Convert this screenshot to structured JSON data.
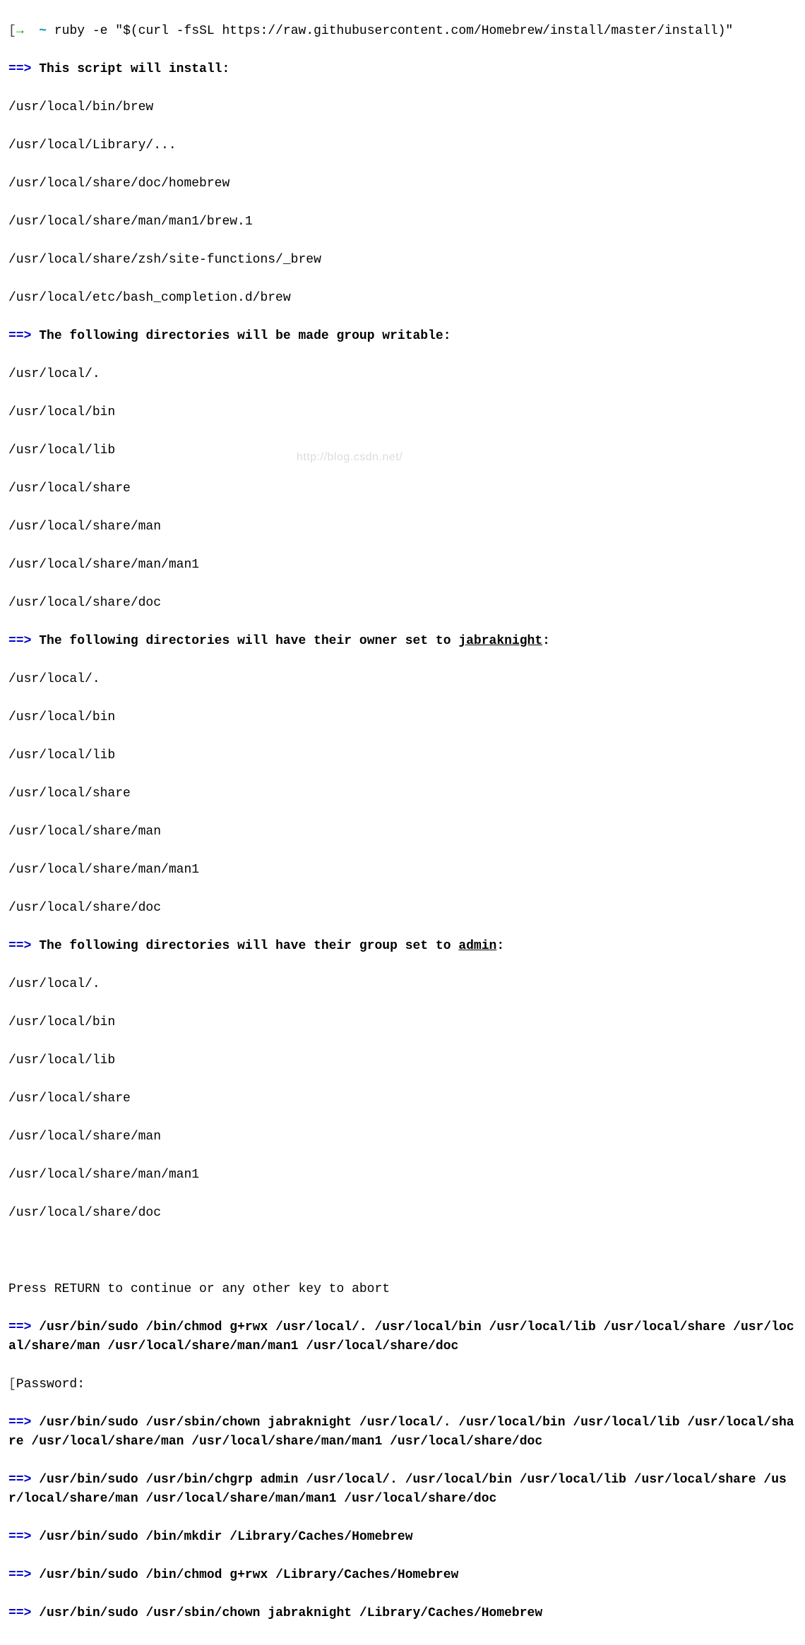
{
  "watermark_text": "http://blog.csdn.net/",
  "prompt": {
    "bracket_open": "[",
    "arrow": "→",
    "tilde": "~",
    "command": "ruby -e \"$(curl -fsSL https://raw.githubusercontent.com/Homebrew/install/master/install)\""
  },
  "marker": "==>",
  "sections": {
    "install": {
      "heading": "This script will install:",
      "lines": [
        "/usr/local/bin/brew",
        "/usr/local/Library/...",
        "/usr/local/share/doc/homebrew",
        "/usr/local/share/man/man1/brew.1",
        "/usr/local/share/zsh/site-functions/_brew",
        "/usr/local/etc/bash_completion.d/brew"
      ]
    },
    "group_writable": {
      "heading": "The following directories will be made group writable:",
      "lines": [
        "/usr/local/.",
        "/usr/local/bin",
        "/usr/local/lib",
        "/usr/local/share",
        "/usr/local/share/man",
        "/usr/local/share/man/man1",
        "/usr/local/share/doc"
      ]
    },
    "owner": {
      "heading_prefix": "The following directories will have their owner set to ",
      "owner_name": "jabraknight",
      "heading_suffix": ":",
      "lines": [
        "/usr/local/.",
        "/usr/local/bin",
        "/usr/local/lib",
        "/usr/local/share",
        "/usr/local/share/man",
        "/usr/local/share/man/man1",
        "/usr/local/share/doc"
      ]
    },
    "group": {
      "heading_prefix": "The following directories will have their group set to ",
      "group_name": "admin",
      "heading_suffix": ":",
      "lines": [
        "/usr/local/.",
        "/usr/local/bin",
        "/usr/local/lib",
        "/usr/local/share",
        "/usr/local/share/man",
        "/usr/local/share/man/man1",
        "/usr/local/share/doc"
      ]
    }
  },
  "press_return": "Press RETURN to continue or any other key to abort",
  "password_bracket_open": "[",
  "password_label": "Password:",
  "commands": {
    "chmod1": "/usr/bin/sudo /bin/chmod g+rwx /usr/local/. /usr/local/bin /usr/local/lib /usr/local/share /usr/local/share/man /usr/local/share/man/man1 /usr/local/share/doc",
    "chown1": "/usr/bin/sudo /usr/sbin/chown jabraknight /usr/local/. /usr/local/bin /usr/local/lib /usr/local/share /usr/local/share/man /usr/local/share/man/man1 /usr/local/share/doc",
    "chgrp1": "/usr/bin/sudo /usr/bin/chgrp admin /usr/local/. /usr/local/bin /usr/local/lib /usr/local/share /usr/local/share/man /usr/local/share/man/man1 /usr/local/share/doc",
    "mkdir1": "/usr/bin/sudo /bin/mkdir /Library/Caches/Homebrew",
    "chmod2": "/usr/bin/sudo /bin/chmod g+rwx /Library/Caches/Homebrew",
    "chown2": "/usr/bin/sudo /usr/sbin/chown jabraknight /Library/Caches/Homebrew"
  }
}
